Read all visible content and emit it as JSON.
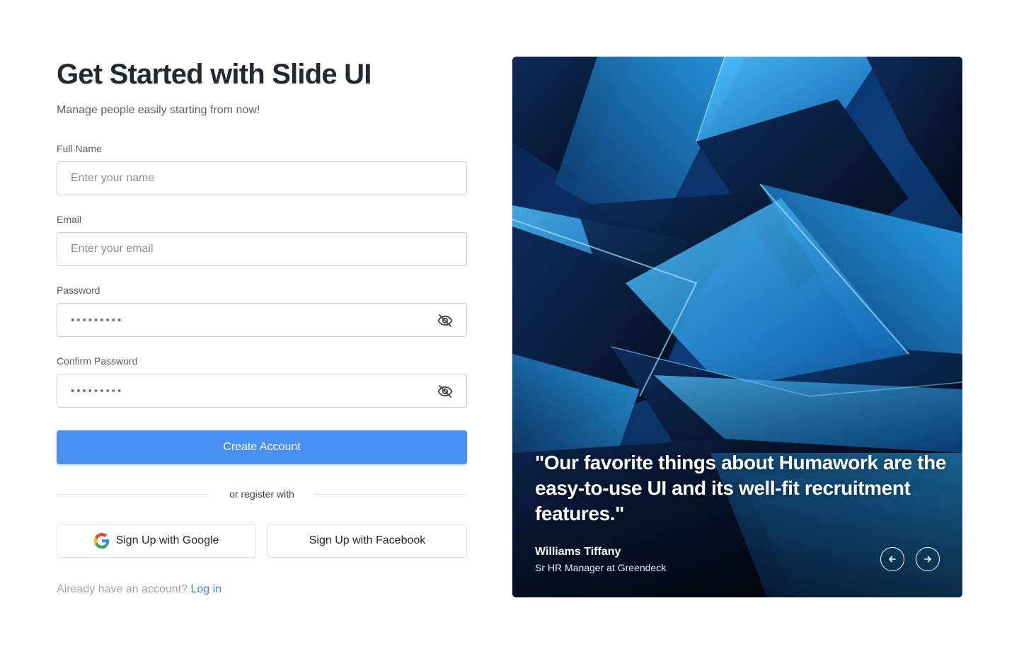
{
  "header": {
    "title": "Get Started with Slide UI",
    "subtitle": "Manage people easily starting from now!"
  },
  "form": {
    "full_name": {
      "label": "Full Name",
      "placeholder": "Enter your name",
      "value": ""
    },
    "email": {
      "label": "Email",
      "placeholder": "Enter your email",
      "value": ""
    },
    "password": {
      "label": "Password",
      "value": "•••••••••"
    },
    "confirm_password": {
      "label": "Confirm Password",
      "value": "•••••••••"
    },
    "submit_label": "Create Account"
  },
  "divider_text": "or register with",
  "social": {
    "google_label": "Sign Up with Google",
    "facebook_label": "Sign Up with Facebook"
  },
  "login": {
    "prompt": "Already have an account?",
    "link_label": "Log in"
  },
  "testimonial": {
    "quote": "\"Our favorite things about Humawork are the easy-to-use UI and its well-fit recruitment features.\"",
    "author": "Williams Tiffany",
    "role": "Sr HR Manager at Greendeck"
  },
  "icons": {
    "password_toggle": "eye-off-icon",
    "prev": "arrow-left-icon",
    "next": "arrow-right-icon",
    "google": "google-icon"
  },
  "colors": {
    "primary": "#4a8ff2",
    "link": "#3b82e0",
    "heading": "#24292f",
    "border": "#c9cdd2"
  }
}
